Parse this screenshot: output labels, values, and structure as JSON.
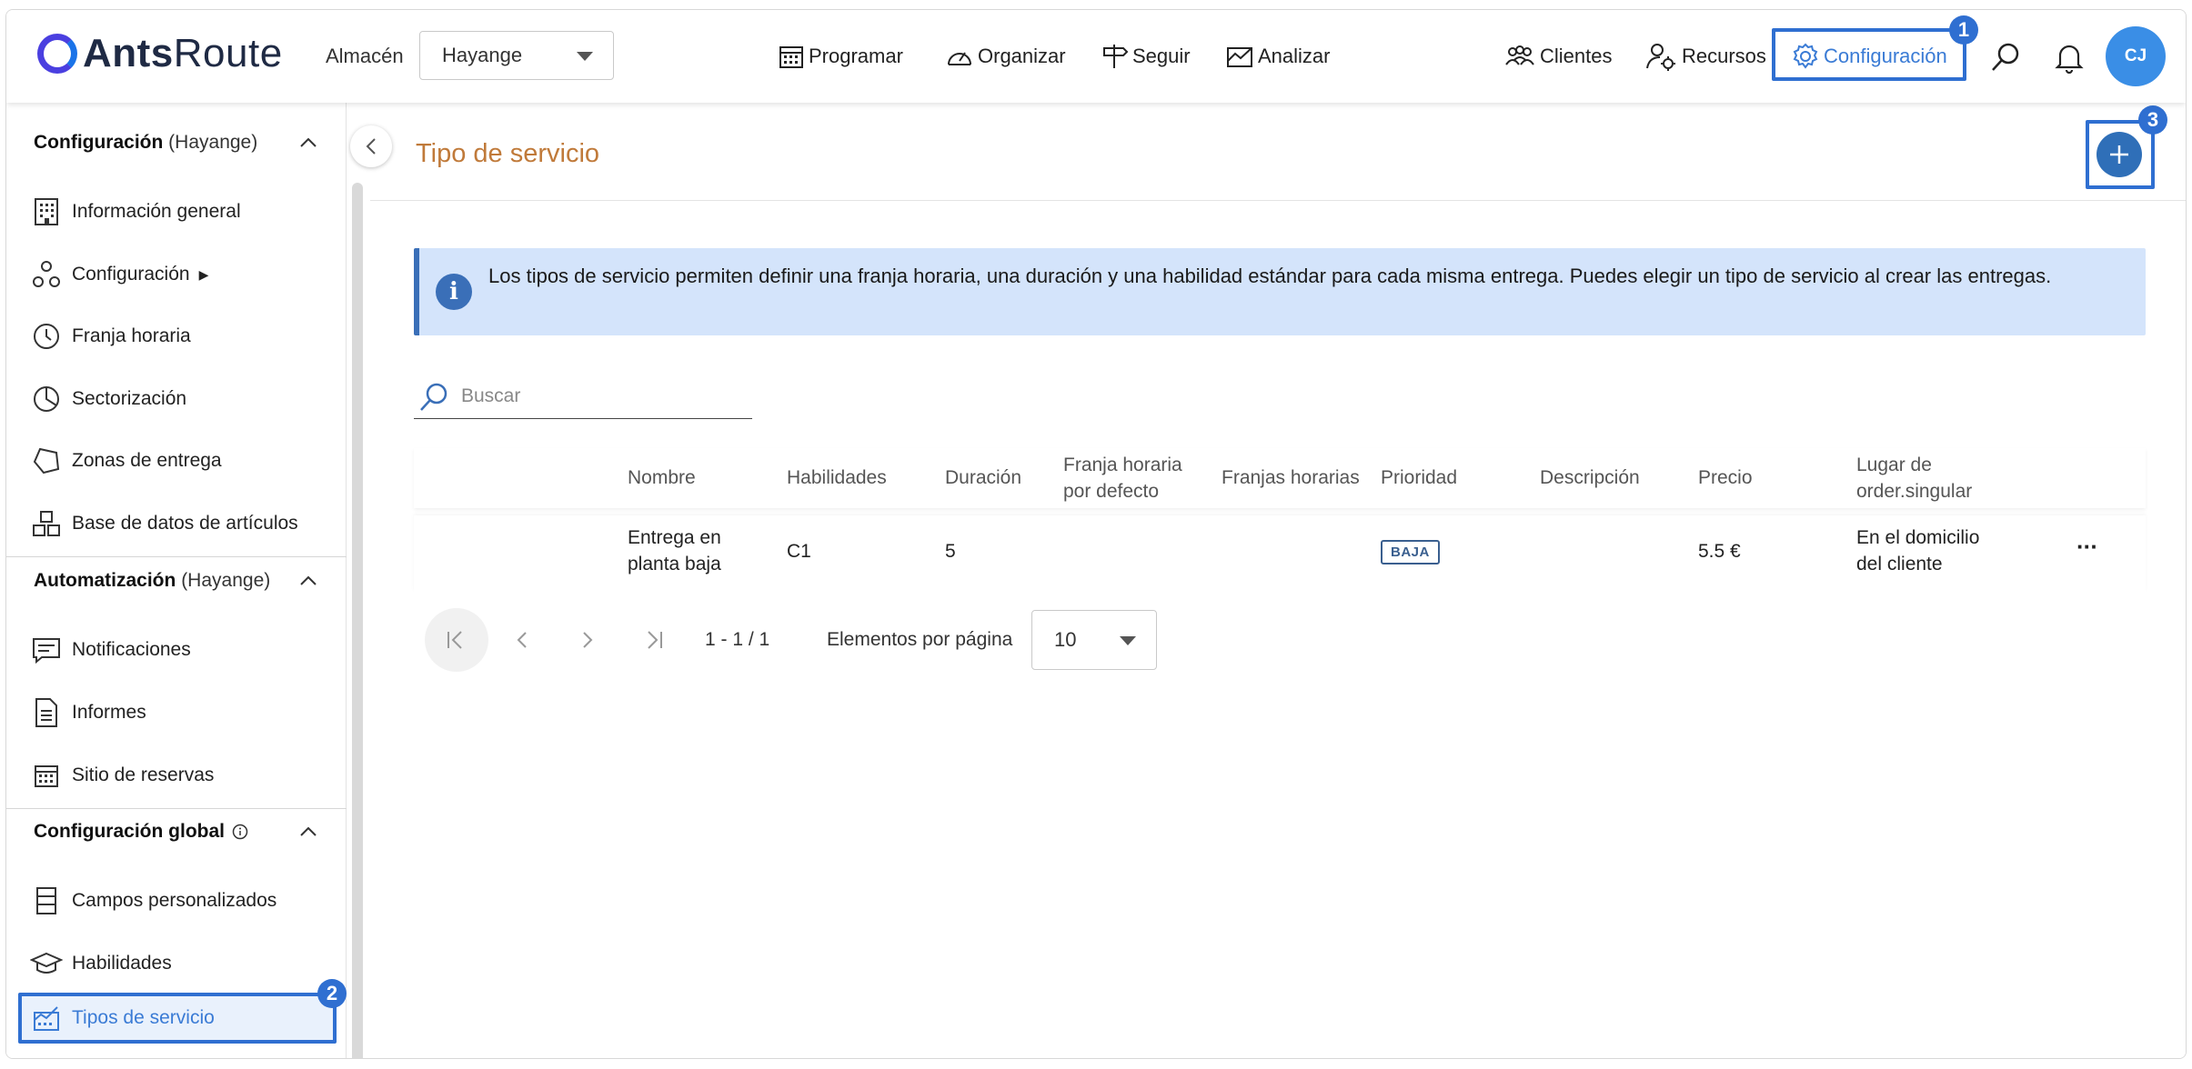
{
  "app": {
    "logo_bold": "Ants",
    "logo_light": "Route"
  },
  "header": {
    "warehouse_label": "Almacén",
    "warehouse_value": "Hayange",
    "nav": {
      "programar": "Programar",
      "organizar": "Organizar",
      "seguir": "Seguir",
      "analizar": "Analizar",
      "clientes": "Clientes",
      "recursos": "Recursos",
      "configuracion": "Configuración"
    },
    "avatar_initials": "CJ"
  },
  "annotations": {
    "step1": "1",
    "step2": "2",
    "step3": "3"
  },
  "sidebar": {
    "section_config": {
      "title": "Configuración",
      "sub": "(Hayange)"
    },
    "config_items": {
      "informacion": "Información general",
      "configuracion": "Configuración",
      "franja": "Franja horaria",
      "sectorizacion": "Sectorización",
      "zonas": "Zonas de entrega",
      "base": "Base de datos de artículos"
    },
    "section_auto": {
      "title": "Automatización",
      "sub": "(Hayange)"
    },
    "auto_items": {
      "notificaciones": "Notificaciones",
      "informes": "Informes",
      "sitio": "Sitio de reservas"
    },
    "section_global": {
      "title": "Configuración global"
    },
    "global_items": {
      "campos": "Campos personalizados",
      "habilidades": "Habilidades",
      "tipos": "Tipos de servicio"
    }
  },
  "main": {
    "title": "Tipo de servicio",
    "info_text": "Los tipos de servicio permiten definir una franja horaria, una duración y una habilidad estándar para cada misma entrega. Puedes elegir un tipo de servicio al crear las entregas.",
    "search_placeholder": "Buscar",
    "table": {
      "headers": {
        "nombre": "Nombre",
        "habilidades": "Habilidades",
        "duracion": "Duración",
        "franja_def_1": "Franja horaria",
        "franja_def_2": "por defecto",
        "franjas": "Franjas horarias",
        "prioridad": "Prioridad",
        "descripcion": "Descripción",
        "precio": "Precio",
        "lugar_1": "Lugar de",
        "lugar_2": "order.singular"
      },
      "rows": [
        {
          "nombre_1": "Entrega en",
          "nombre_2": "planta baja",
          "habilidades": "C1",
          "duracion": "5",
          "prioridad": "BAJA",
          "precio": "5.5 €",
          "lugar_1": "En el domicilio",
          "lugar_2": "del cliente",
          "menu": "···"
        }
      ]
    },
    "pager": {
      "range": "1 - 1 / 1",
      "per_page_label": "Elementos por página",
      "per_page_value": "10"
    }
  },
  "colors": {
    "accent": "#2f6fd1",
    "title": "#c07a3a",
    "info_bg": "#d4e4fb"
  }
}
